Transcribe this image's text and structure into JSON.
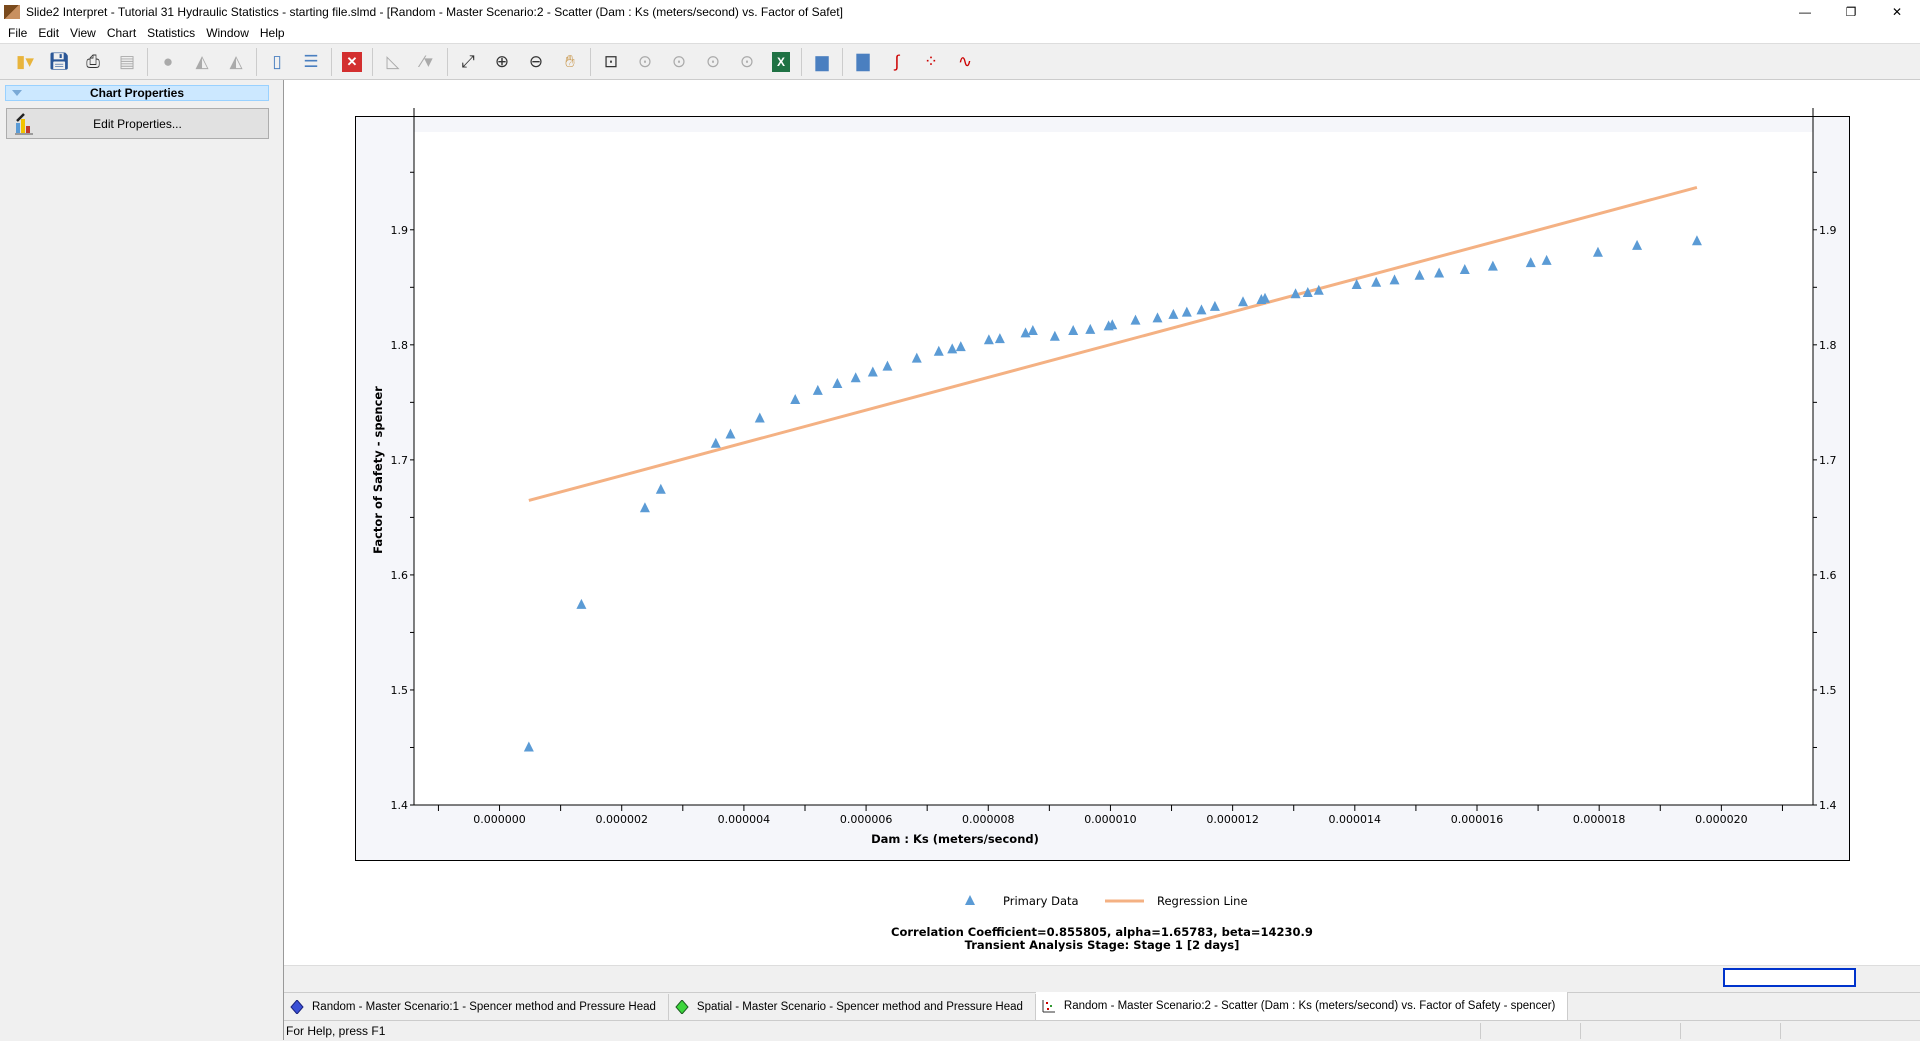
{
  "window": {
    "title": "Slide2 Interpret - Tutorial 31 Hydraulic Statistics - starting file.slmd - [Random - Master Scenario:2 - Scatter (Dam : Ks (meters/second) vs. Factor of Safet]",
    "minimize": "—",
    "restore": "❐",
    "close": "✕"
  },
  "menu": [
    "File",
    "Edit",
    "View",
    "Chart",
    "Statistics",
    "Window",
    "Help"
  ],
  "toolbar": {
    "icons": [
      "open-folder-icon",
      "save-icon",
      "print-icon",
      "print-preview-icon",
      "sphere-icon",
      "chart-area-icon",
      "chart-area-drops-icon",
      "tile-vertical-icon",
      "tile-horizontal-icon",
      "close-red-icon",
      "slope-icon",
      "line-tool-icon",
      "zoom-extents-icon",
      "zoom-in-icon",
      "zoom-out-icon",
      "pan-hand-icon",
      "zoom-window-icon",
      "zoom-all-icon",
      "zoom-previous-icon",
      "zoom-select-icon",
      "zoom-lock-icon",
      "excel-icon",
      "chart-properties-icon",
      "histogram-icon",
      "cumulative-icon",
      "scatter-icon",
      "sampler-icon"
    ]
  },
  "left_panel": {
    "header": "Chart Properties",
    "edit_button": "Edit Properties..."
  },
  "chart_data": {
    "type": "scatter",
    "xlabel": "Dam : Ks (meters/second)",
    "ylabel": "Factor of Safety - spencer",
    "xlim": [
      -1.4e-06,
      2.15e-05
    ],
    "ylim": [
      1.4,
      1.985
    ],
    "x_ticks": [
      "0.000000",
      "0.000002",
      "0.000004",
      "0.000006",
      "0.000008",
      "0.000010",
      "0.000012",
      "0.000014",
      "0.000016",
      "0.000018",
      "0.000020"
    ],
    "x_tick_values": [
      0,
      2e-06,
      4e-06,
      6e-06,
      8e-06,
      1e-05,
      1.2e-05,
      1.4e-05,
      1.6e-05,
      1.8e-05,
      2e-05
    ],
    "y_ticks": [
      "1.4",
      "1.5",
      "1.6",
      "1.7",
      "1.8",
      "1.9"
    ],
    "y_tick_values": [
      1.4,
      1.5,
      1.6,
      1.7,
      1.8,
      1.9
    ],
    "grid": false,
    "legend_position": "bottom",
    "series": [
      {
        "name": "Primary Data",
        "marker": "triangle",
        "color": "#5b9bd5",
        "x": [
          4.8e-07,
          1.34e-06,
          2.38e-06,
          2.64e-06,
          3.54e-06,
          3.78e-06,
          4.26e-06,
          4.84e-06,
          5.21e-06,
          5.53e-06,
          5.83e-06,
          6.11e-06,
          6.35e-06,
          6.83e-06,
          7.19e-06,
          7.41e-06,
          7.55e-06,
          8.01e-06,
          8.19e-06,
          8.61e-06,
          8.73e-06,
          9.09e-06,
          9.39e-06,
          9.67e-06,
          9.97e-06,
          1.003e-05,
          1.041e-05,
          1.077e-05,
          1.103e-05,
          1.125e-05,
          1.149e-05,
          1.171e-05,
          1.217e-05,
          1.247e-05,
          1.253e-05,
          1.303e-05,
          1.323e-05,
          1.341e-05,
          1.403e-05,
          1.435e-05,
          1.465e-05,
          1.506e-05,
          1.538e-05,
          1.58e-05,
          1.626e-05,
          1.688e-05,
          1.714e-05,
          1.798e-05,
          1.862e-05,
          1.96e-05
        ],
        "y": [
          1.45,
          1.574,
          1.658,
          1.674,
          1.714,
          1.722,
          1.736,
          1.752,
          1.76,
          1.766,
          1.771,
          1.776,
          1.781,
          1.788,
          1.794,
          1.796,
          1.798,
          1.804,
          1.805,
          1.81,
          1.812,
          1.807,
          1.812,
          1.813,
          1.816,
          1.817,
          1.821,
          1.823,
          1.826,
          1.828,
          1.83,
          1.833,
          1.837,
          1.839,
          1.84,
          1.844,
          1.845,
          1.847,
          1.852,
          1.854,
          1.856,
          1.86,
          1.862,
          1.865,
          1.868,
          1.871,
          1.873,
          1.88,
          1.886,
          1.89
        ]
      },
      {
        "name": "Regression Line",
        "type": "line",
        "color": "#f4b183",
        "x": [
          4.8e-07,
          1.96e-05
        ],
        "y": [
          1.6647,
          1.9368
        ]
      }
    ],
    "caption": [
      "Correlation Coefficient=0.855805, alpha=1.65783, beta=14230.9",
      "Transient Analysis Stage: Stage 1 [2 days]"
    ]
  },
  "tabs": [
    {
      "label": "Random - Master Scenario:1 - Spencer method and Pressure Head",
      "icon": "blue-diamond-icon",
      "color": "#3a4fd6"
    },
    {
      "label": "Spatial - Master Scenario - Spencer method and Pressure Head",
      "icon": "green-diamond-icon",
      "color": "#3cd63c"
    },
    {
      "label": "Random - Master Scenario:2 - Scatter (Dam : Ks (meters/second) vs. Factor of Safety - spencer)",
      "icon": "scatter-icon",
      "active": true
    }
  ],
  "status": "For Help, press F1"
}
